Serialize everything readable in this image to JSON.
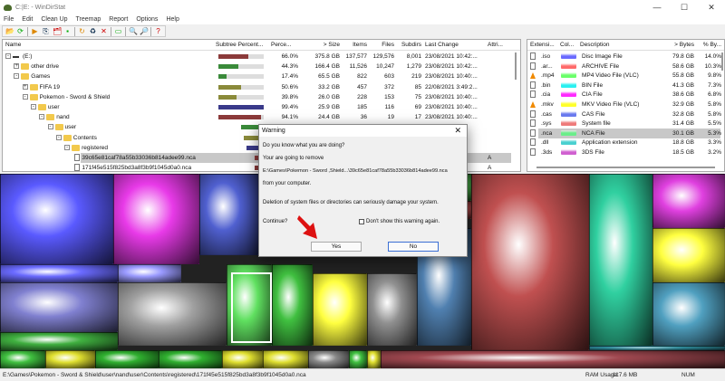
{
  "window": {
    "title": "C:|E: - WinDirStat",
    "controls": [
      "—",
      "☐",
      "✕"
    ]
  },
  "menu": [
    "File",
    "Edit",
    "Clean Up",
    "Treemap",
    "Report",
    "Options",
    "Help"
  ],
  "toolbar": {
    "icons": [
      "open-icon",
      "refresh-icon",
      "play-icon",
      "copy-icon",
      "explorer-icon",
      "cmd-icon",
      "refresh-all-icon",
      "recycle-icon",
      "delete-icon",
      "properties-icon",
      "zoom-in-icon",
      "zoom-out-icon",
      "help-icon"
    ],
    "glyphs": [
      "📂",
      "⟳",
      "▶",
      "⎘",
      "🗂",
      "▪",
      "↻",
      "♻",
      "✕",
      "▭",
      "🔍",
      "🔎",
      "?"
    ]
  },
  "tree": {
    "columns": [
      "Name",
      "Subtree Percent...",
      "Perce...",
      "> Size",
      "Items",
      "Files",
      "Subdirs",
      "Last Change",
      "Attri..."
    ],
    "rows": [
      {
        "name": "(E:)",
        "depth": 0,
        "type": "drive",
        "exp": "⊟",
        "pct_bar": 66.0,
        "bar_color": "#8b3a3a",
        "perc": "66.0%",
        "size": "375.8 GB",
        "items": "137,577",
        "files": "129,576",
        "subdirs": "8,001",
        "change": "23/08/2021 10:42:...",
        "attr": ""
      },
      {
        "name": "other drive",
        "depth": 1,
        "type": "folder",
        "exp": "⊞",
        "pct_bar": 44.3,
        "bar_color": "#3a8a3a",
        "perc": "44.3%",
        "size": "166.4 GB",
        "items": "11,526",
        "files": "10,247",
        "subdirs": "1,279",
        "change": "23/08/2021 10:42:...",
        "attr": ""
      },
      {
        "name": "Games",
        "depth": 1,
        "type": "folder",
        "exp": "⊟",
        "pct_bar": 17.4,
        "bar_color": "#3a8a3a",
        "perc": "17.4%",
        "size": "65.5 GB",
        "items": "822",
        "files": "603",
        "subdirs": "219",
        "change": "23/08/2021 10:40:...",
        "attr": ""
      },
      {
        "name": "FIFA 19",
        "depth": 2,
        "type": "folder",
        "exp": "⊞",
        "pct_bar": 50.6,
        "bar_color": "#8a8a3a",
        "perc": "50.6%",
        "size": "33.2 GB",
        "items": "457",
        "files": "372",
        "subdirs": "85",
        "change": "22/08/2021 3:49:2...",
        "attr": ""
      },
      {
        "name": "Pokemon - Sword & Shield",
        "depth": 2,
        "type": "folder",
        "exp": "⊟",
        "pct_bar": 39.8,
        "bar_color": "#8a8a3a",
        "perc": "39.8%",
        "size": "26.0 GB",
        "items": "228",
        "files": "153",
        "subdirs": "75",
        "change": "23/08/2021 10:40:...",
        "attr": ""
      },
      {
        "name": "user",
        "depth": 3,
        "type": "folder",
        "exp": "⊟",
        "pct_bar": 99.4,
        "bar_color": "#3a3a8a",
        "perc": "99.4%",
        "size": "25.9 GB",
        "items": "185",
        "files": "116",
        "subdirs": "69",
        "change": "23/08/2021 10:40:...",
        "attr": ""
      },
      {
        "name": "nand",
        "depth": 4,
        "type": "folder",
        "exp": "⊟",
        "pct_bar": 94.1,
        "bar_color": "#8b3a3a",
        "perc": "94.1%",
        "size": "24.4 GB",
        "items": "36",
        "files": "19",
        "subdirs": "17",
        "change": "23/08/2021 10:40:...",
        "attr": ""
      },
      {
        "name": "user",
        "depth": 5,
        "type": "folder",
        "exp": "⊟",
        "pct_bar": 90,
        "bar_color": "#3a8a3a",
        "perc": "",
        "size": "",
        "items": "",
        "files": "",
        "subdirs": "",
        "change": "",
        "attr": ""
      },
      {
        "name": "Contents",
        "depth": 6,
        "type": "folder",
        "exp": "⊟",
        "pct_bar": 80,
        "bar_color": "#8a8a3a",
        "perc": "",
        "size": "",
        "items": "",
        "files": "",
        "subdirs": "",
        "change": "",
        "attr": ""
      },
      {
        "name": "registered",
        "depth": 7,
        "type": "folder",
        "exp": "⊟",
        "pct_bar": 70,
        "bar_color": "#3a3a8a",
        "perc": "",
        "size": "",
        "items": "",
        "files": "",
        "subdirs": "",
        "change": "",
        "attr": ""
      },
      {
        "name": "39c65e81caf78a55b33036b814adee99.nca",
        "depth": 8,
        "type": "file",
        "exp": "",
        "pct_bar": 40,
        "bar_color": "#8b3a3a",
        "perc": "",
        "size": "",
        "items": "",
        "files": "",
        "subdirs": "",
        "change": "",
        "attr": "A",
        "selected": true
      },
      {
        "name": "171f45e515f825bd3a8f3b9f1045d0a0.nca",
        "depth": 8,
        "type": "file",
        "exp": "",
        "pct_bar": 40,
        "bar_color": "#8b3a3a",
        "perc": "",
        "size": "",
        "items": "",
        "files": "",
        "subdirs": "",
        "change": "",
        "attr": "A"
      }
    ]
  },
  "extensions": {
    "columns": [
      "Extensi...",
      "Col...",
      "Description",
      "> Bytes",
      "% By..."
    ],
    "rows": [
      {
        "ext": ".iso",
        "color": "#6a6aff",
        "desc": "Disc Image File",
        "bytes": "79.8 GB",
        "pct": "14.0%",
        "icon": "file-icon"
      },
      {
        "ext": ".ar...",
        "color": "#ff6a6a",
        "desc": "ARCHIVE File",
        "bytes": "58.6 GB",
        "pct": "10.3%",
        "icon": "file-icon"
      },
      {
        "ext": ".mp4",
        "color": "#6aff6a",
        "desc": "MP4 Video File (VLC)",
        "bytes": "55.8 GB",
        "pct": "9.8%",
        "icon": "vlc-icon"
      },
      {
        "ext": ".bin",
        "color": "#2af0f0",
        "desc": "BIN File",
        "bytes": "41.3 GB",
        "pct": "7.3%",
        "icon": "file-icon"
      },
      {
        "ext": ".cia",
        "color": "#ff2aff",
        "desc": "CIA File",
        "bytes": "38.6 GB",
        "pct": "6.8%",
        "icon": "file-icon"
      },
      {
        "ext": ".mkv",
        "color": "#ffff2a",
        "desc": "MKV Video File (VLC)",
        "bytes": "32.9 GB",
        "pct": "5.8%",
        "icon": "vlc-icon"
      },
      {
        "ext": ".cas",
        "color": "#6a7aee",
        "desc": "CAS File",
        "bytes": "32.8 GB",
        "pct": "5.8%",
        "icon": "file-icon"
      },
      {
        "ext": ".sys",
        "color": "#ee7a7a",
        "desc": "System file",
        "bytes": "31.4 GB",
        "pct": "5.5%",
        "icon": "system-file-icon"
      },
      {
        "ext": ".nca",
        "color": "#6aee8a",
        "desc": "NCA File",
        "bytes": "30.1 GB",
        "pct": "5.3%",
        "icon": "file-icon",
        "selected": true
      },
      {
        "ext": ".dll",
        "color": "#4ad0d0",
        "desc": "Application extension",
        "bytes": "18.8 GB",
        "pct": "3.3%",
        "icon": "system-file-icon"
      },
      {
        "ext": ".3ds",
        "color": "#d060d0",
        "desc": "3DS File",
        "bytes": "18.5 GB",
        "pct": "3.2%",
        "icon": "file-icon"
      }
    ]
  },
  "dialog": {
    "title": "Warning",
    "line1": "Do you know what you are doing?",
    "line2": "Your are going to remove",
    "path": "E:\\Games\\Pokemon - Sword ,Shield...\\39c65e81caf78a55b33036b814adee99.nca",
    "line3": "from your computer.",
    "line4": "Deletion of system files or directories can seriously damage your system.",
    "continue": "Continue?",
    "checkbox": "Don't show this warning again.",
    "checkbox_checked": false,
    "yes": "Yes",
    "no": "No",
    "close": "✕"
  },
  "status": {
    "path": "E:\\Games\\Pokemon - Sword & Shield\\user\\nand\\user\\Contents\\registered\\171f45e515f825bd3a8f3b9f1045d0a0.nca",
    "ram_label": "RAM Usage:",
    "ram": "117.6 MB",
    "num": "NUM"
  }
}
